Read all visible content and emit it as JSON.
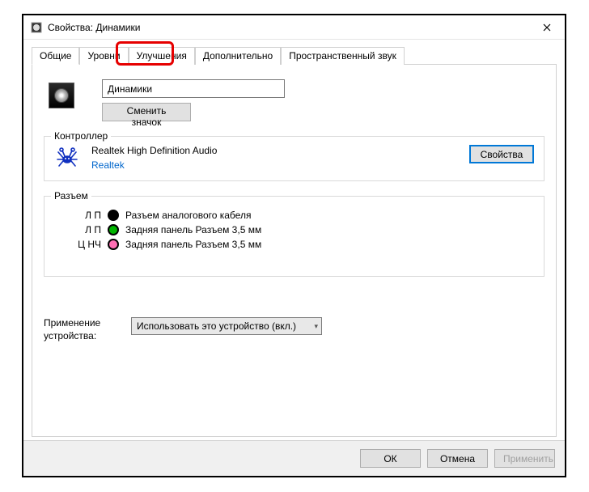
{
  "window": {
    "title": "Свойства: Динамики"
  },
  "tabs": {
    "general": "Общие",
    "levels": "Уровни",
    "enhancements": "Улучшения",
    "advanced": "Дополнительно",
    "spatial": "Пространственный звук"
  },
  "device_name": "Динамики",
  "change_icon_btn": "Сменить значок",
  "controller": {
    "group_title": "Контроллер",
    "name": "Realtek High Definition Audio",
    "vendor": "Realtek",
    "properties_btn": "Свойства"
  },
  "jack": {
    "group_title": "Разъем",
    "rows": [
      {
        "label": "Л П",
        "color": "black",
        "desc": "Разъем аналогового кабеля"
      },
      {
        "label": "Л П",
        "color": "green",
        "desc": "Задняя панель Разъем 3,5 мм"
      },
      {
        "label": "Ц НЧ",
        "color": "pink",
        "desc": "Задняя панель Разъем 3,5 мм"
      }
    ]
  },
  "usage": {
    "label": "Применение устройства:",
    "selected": "Использовать это устройство (вкл.)"
  },
  "buttons": {
    "ok": "ОК",
    "cancel": "Отмена",
    "apply": "Применить"
  }
}
